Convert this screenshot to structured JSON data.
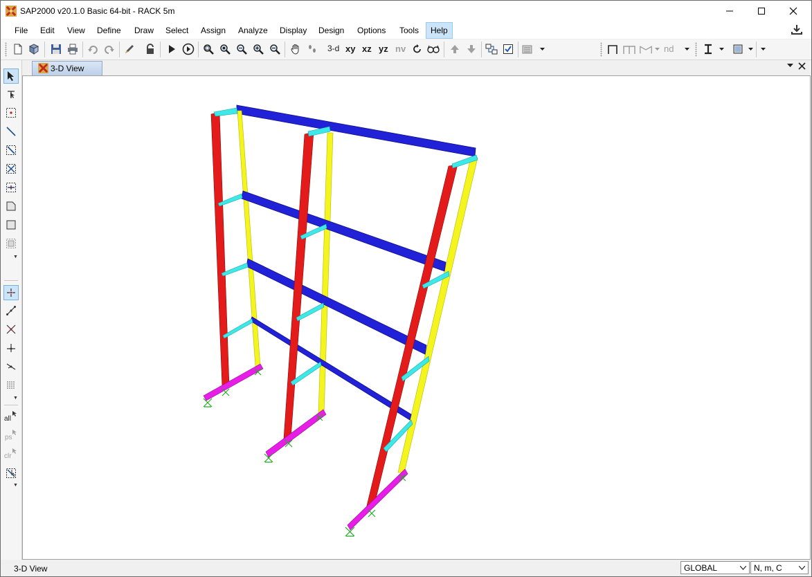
{
  "window": {
    "title": "SAP2000 v20.1.0 Basic 64-bit - RACK 5m"
  },
  "menu": {
    "items": [
      "File",
      "Edit",
      "View",
      "Define",
      "Draw",
      "Select",
      "Assign",
      "Analyze",
      "Display",
      "Design",
      "Options",
      "Tools",
      "Help"
    ],
    "active": "Help"
  },
  "toolbar": {
    "view_3d": "3-d",
    "view_xy": "xy",
    "view_xz": "xz",
    "view_yz": "yz",
    "view_nv": "nv",
    "nd_label": "nd"
  },
  "left_toolbar": {
    "all_label": "all",
    "ps_label": "ps",
    "clr_label": "clr"
  },
  "tab": {
    "label": "3-D View"
  },
  "status": {
    "view_name": "3-D View",
    "coord_system": "GLOBAL",
    "units": "N, m, C"
  },
  "colors": {
    "beam": "#1f1fd6",
    "front_column": "#e01a1a",
    "back_column": "#f2f21a",
    "brace": "#33e6e6",
    "base": "#e01ae0",
    "support": "#22aa22",
    "accent": "#cce4f7"
  }
}
